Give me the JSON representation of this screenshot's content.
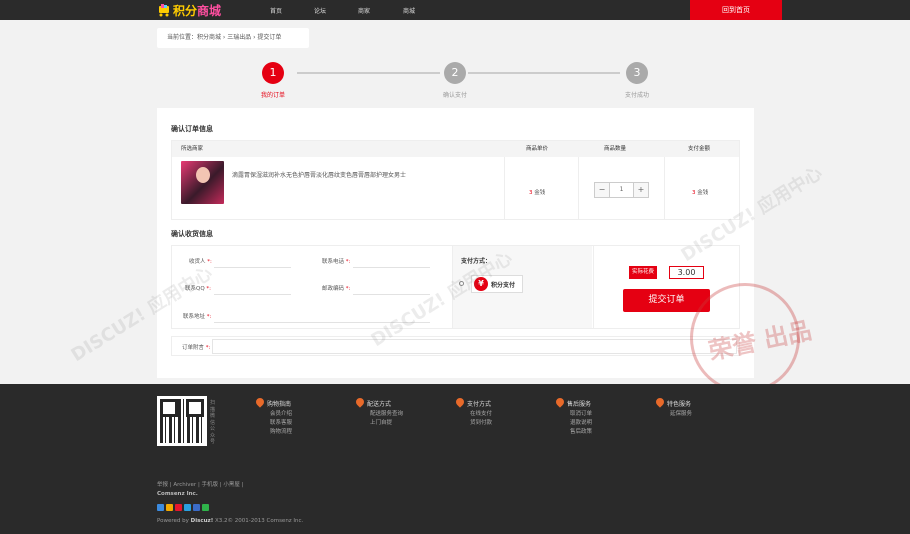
{
  "header": {
    "logo_text_a": "积分",
    "logo_text_b": "商城",
    "nav": [
      "首页",
      "论坛",
      "商家",
      "商城"
    ],
    "home_button": "回到首页"
  },
  "breadcrumb": {
    "text": "当前位置：积分商城 › 三瑞出品 › 提交订单"
  },
  "steps": [
    {
      "num": "1",
      "label": "我的订单",
      "active": true
    },
    {
      "num": "2",
      "label": "确认支付",
      "active": false
    },
    {
      "num": "3",
      "label": "支付成功",
      "active": false
    }
  ],
  "order": {
    "section_title": "确认订单信息",
    "headers": {
      "seller": "所选商家",
      "price": "商品单价",
      "qty": "商品数量",
      "total": "支付金额"
    },
    "product_name": "滴露胃保湿滋润补水无色护唇膏淡化唇纹变色唇膏唇部护理女男士",
    "unit_price_num": "3",
    "unit_price_unit": "金钱",
    "qty_minus": "−",
    "qty_value": "1",
    "qty_plus": "+",
    "total_num": "3",
    "total_unit": "金钱"
  },
  "receiver": {
    "section_title": "确认收货信息",
    "fields": {
      "name": "收货人",
      "phone": "联系电话",
      "qq": "联系QQ",
      "zip": "邮政编码",
      "address": "联系地址",
      "note": "订单附言"
    },
    "required_mark": "*:"
  },
  "payment": {
    "title": "支付方式：",
    "icon": "¥",
    "option": "积分支付"
  },
  "summary": {
    "label": "实际花费",
    "value": "3.00",
    "submit": "提交订单"
  },
  "footer": {
    "qr_side": "扫描微信公众号",
    "columns": [
      {
        "title": "购物指南",
        "items": [
          "会员介绍",
          "联系客服",
          "购物流程"
        ]
      },
      {
        "title": "配送方式",
        "items": [
          "配送服务查询",
          "上门自提"
        ]
      },
      {
        "title": "支付方式",
        "items": [
          "在线支付",
          "货到付款"
        ]
      },
      {
        "title": "售后服务",
        "items": [
          "取消订单",
          "退款说明",
          "售后政策"
        ]
      },
      {
        "title": "特色服务",
        "items": [
          "延保服务"
        ]
      }
    ],
    "links": "举报 | Archiver | 手机版 | 小黑屋 |",
    "company": "Comsenz Inc.",
    "powered_prefix": "Powered by ",
    "powered_brand": "Discuz!",
    "powered_suffix": " X3.2© 2001-2013 Comsenz Inc."
  },
  "colors": {
    "accent": "#e50012",
    "topbar": "#2b2b2b",
    "footer": "#2a2a2a"
  }
}
